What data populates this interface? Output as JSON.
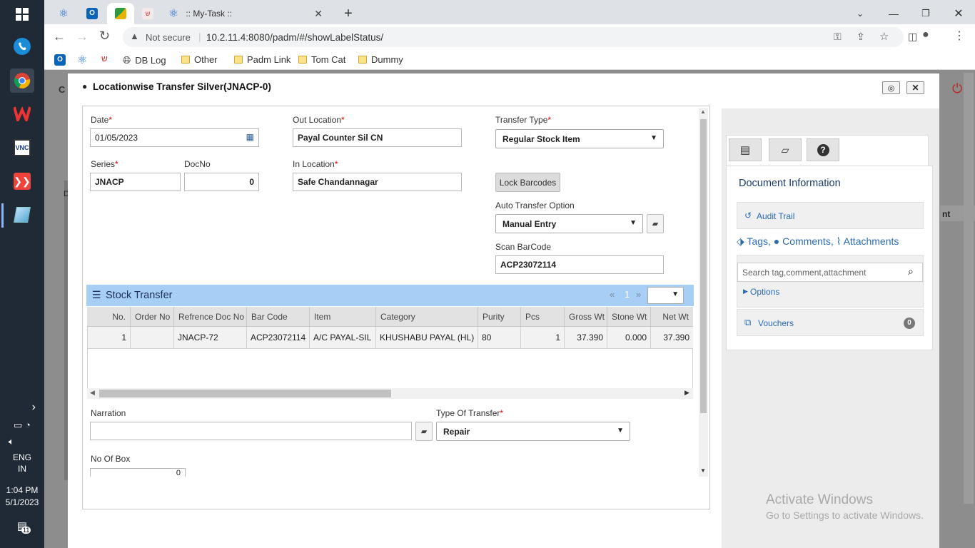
{
  "taskbar": {
    "time": "1:04 PM",
    "date": "5/1/2023",
    "lang": "ENG",
    "region": "IN",
    "notif_count": "11"
  },
  "browser": {
    "active_tab_title": ":: My-Task ::",
    "security_label": "Not secure",
    "url": "10.2.11.4:8080/padm/#/showLabelStatus/",
    "bookmarks": [
      "DB Log",
      "Other",
      "Padm Link",
      "Tom Cat",
      "Dummy"
    ]
  },
  "dialog": {
    "title": "Locationwise Transfer Silver(JNACP-0)"
  },
  "form": {
    "date_label": "Date",
    "date_value": "01/05/2023",
    "series_label": "Series",
    "series_value": "JNACP",
    "docno_label": "DocNo",
    "docno_value": "0",
    "out_location_label": "Out Location",
    "out_location_value": "Payal Counter Sil CN",
    "in_location_label": "In Location",
    "in_location_value": "Safe Chandannagar",
    "transfer_type_label": "Transfer Type",
    "transfer_type_value": "Regular Stock Item",
    "lock_barcodes_label": "Lock Barcodes",
    "auto_transfer_label": "Auto Transfer Option",
    "auto_transfer_value": "Manual Entry",
    "scan_barcode_label": "Scan BarCode",
    "scan_barcode_value": "ACP23072114",
    "narration_label": "Narration",
    "narration_value": "",
    "type_of_transfer_label": "Type Of Transfer",
    "type_of_transfer_value": "Repair",
    "no_of_box_label": "No Of Box",
    "no_of_box_value": "0"
  },
  "stock_transfer": {
    "title": "Stock Transfer",
    "pager_prev": "«",
    "pager_page": "1",
    "pager_next": "»",
    "columns": [
      "No.",
      "Order No",
      "Refrence Doc No",
      "Bar Code",
      "Item",
      "Category",
      "Purity",
      "Pcs",
      "Gross Wt",
      "Stone Wt",
      "Net Wt"
    ],
    "rows": [
      [
        "1",
        "",
        "JNACP-72",
        "ACP23072114",
        "A/C PAYAL-SIL",
        "KHUSHABU PAYAL (HL)",
        "80",
        "1",
        "37.390",
        "0.000",
        "37.390"
      ]
    ]
  },
  "side_panel": {
    "doc_info_title": "Document Information",
    "audit_trail": "Audit Trail",
    "tags": "Tags,",
    "comments": "Comments,",
    "attachments": "Attachments",
    "search_placeholder": "Search tag,comment,attachment",
    "options": "Options",
    "vouchers": "Vouchers",
    "vouchers_count": "0"
  },
  "watermark": {
    "line1": "Activate Windows",
    "line2": "Go to Settings to activate Windows."
  },
  "background_fragments": {
    "left_c": "C",
    "right_nt": "nt",
    "d_header": "D"
  },
  "colors": {
    "taskbar_bg": "#1f2a36",
    "grid_header_blue": "#a7cff5",
    "link_blue": "#2a6bb5",
    "required_red": "#d00"
  }
}
